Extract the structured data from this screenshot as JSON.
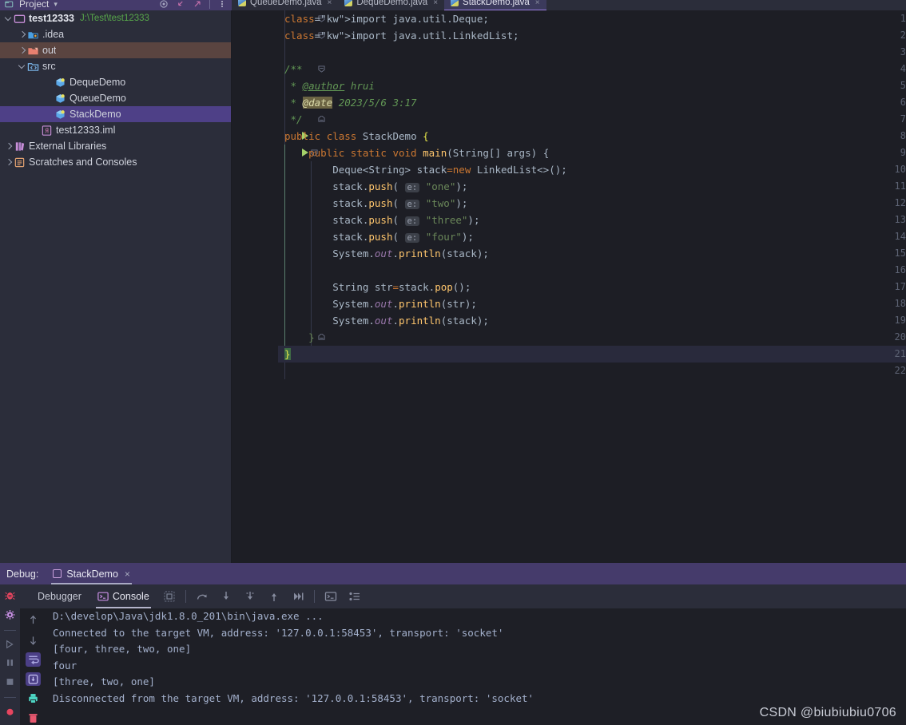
{
  "project_panel": {
    "title": "Project",
    "icons": [
      "target-icon",
      "collapse-all-icon",
      "expand-arrow-icon",
      "more-options-icon"
    ],
    "tree": [
      {
        "label": "test12333",
        "path": "J:\\Test\\test12333",
        "icon": "folder-project-icon",
        "arrow": "down",
        "indent": 0,
        "state": "normal",
        "bold": true
      },
      {
        "label": ".idea",
        "path": "",
        "icon": "folder-idea-icon",
        "arrow": "right",
        "indent": 1,
        "state": "normal",
        "bold": false
      },
      {
        "label": "out",
        "path": "",
        "icon": "folder-excluded-icon",
        "arrow": "right",
        "indent": 1,
        "state": "excluded",
        "bold": false
      },
      {
        "label": "src",
        "path": "",
        "icon": "folder-source-icon",
        "arrow": "down",
        "indent": 1,
        "state": "normal",
        "bold": false
      },
      {
        "label": "DequeDemo",
        "path": "",
        "icon": "java-class-icon",
        "arrow": "none",
        "indent": 3,
        "state": "normal",
        "bold": false
      },
      {
        "label": "QueueDemo",
        "path": "",
        "icon": "java-class-icon",
        "arrow": "none",
        "indent": 3,
        "state": "normal",
        "bold": false
      },
      {
        "label": "StackDemo",
        "path": "",
        "icon": "java-class-icon",
        "arrow": "none",
        "indent": 3,
        "state": "selected",
        "bold": false
      },
      {
        "label": "test12333.iml",
        "path": "",
        "icon": "iml-file-icon",
        "arrow": "none",
        "indent": 2,
        "state": "normal",
        "bold": false
      },
      {
        "label": "External Libraries",
        "path": "",
        "icon": "libraries-icon",
        "arrow": "right",
        "indent": 0,
        "state": "normal",
        "bold": false
      },
      {
        "label": "Scratches and Consoles",
        "path": "",
        "icon": "scratches-icon",
        "arrow": "right",
        "indent": 0,
        "state": "normal",
        "bold": false
      }
    ]
  },
  "editor_tabs": [
    {
      "label": "QueueDemo.java",
      "icon": "java-class-icon",
      "active": false
    },
    {
      "label": "DequeDemo.java",
      "icon": "java-class-icon",
      "active": false
    },
    {
      "label": "StackDemo.java",
      "icon": "java-class-icon",
      "active": true
    }
  ],
  "editor": {
    "file": "StackDemo.java",
    "caret_line": 21,
    "lines": [
      {
        "n": 1,
        "text": "import java.util.Deque;"
      },
      {
        "n": 2,
        "text": "import java.util.LinkedList;"
      },
      {
        "n": 3,
        "text": ""
      },
      {
        "n": 4,
        "text": "/**"
      },
      {
        "n": 5,
        "text": " * @author hrui"
      },
      {
        "n": 6,
        "text": " * @date 2023/5/6 3:17"
      },
      {
        "n": 7,
        "text": " */"
      },
      {
        "n": 8,
        "text": "public class StackDemo {"
      },
      {
        "n": 9,
        "text": "    public static void main(String[] args) {"
      },
      {
        "n": 10,
        "text": "        Deque<String> stack=new LinkedList<>();"
      },
      {
        "n": 11,
        "text": "        stack.push( e: \"one\");"
      },
      {
        "n": 12,
        "text": "        stack.push( e: \"two\");"
      },
      {
        "n": 13,
        "text": "        stack.push( e: \"three\");"
      },
      {
        "n": 14,
        "text": "        stack.push( e: \"four\");"
      },
      {
        "n": 15,
        "text": "        System.out.println(stack);"
      },
      {
        "n": 16,
        "text": ""
      },
      {
        "n": 17,
        "text": "        String str=stack.pop();"
      },
      {
        "n": 18,
        "text": "        System.out.println(str);"
      },
      {
        "n": 19,
        "text": "        System.out.println(stack);"
      },
      {
        "n": 20,
        "text": "    }"
      },
      {
        "n": 21,
        "text": "}"
      },
      {
        "n": 22,
        "text": ""
      }
    ],
    "javadoc": {
      "author_tag": "@author",
      "author_value": "hrui",
      "date_tag": "@date",
      "date_value": "2023/5/6 3:17"
    },
    "param_hint": "e:",
    "run_gutter_lines": [
      8,
      9
    ]
  },
  "debug": {
    "title": "Debug:",
    "session_tab": "StackDemo",
    "close_glyph": "×",
    "sub_tabs": [
      {
        "label": "Debugger",
        "active": false,
        "icon": ""
      },
      {
        "label": "Console",
        "active": true,
        "icon": "console-icon"
      }
    ],
    "toolbar_icons": [
      "layout-settings-icon",
      "step-over-icon",
      "step-into-icon",
      "force-step-into-icon",
      "step-out-icon",
      "run-to-cursor-icon",
      "show-console-icon",
      "settings-list-icon"
    ],
    "left_rail_icons": [
      "debug-bug-icon",
      "settings-gear-icon",
      "resume-program-icon",
      "pause-program-icon",
      "stop-program-icon",
      "mute-breakpoints-icon"
    ],
    "console_gutter_icons": [
      "scroll-up-icon",
      "scroll-down-icon",
      "soft-wrap-icon",
      "scroll-to-end-icon",
      "print-icon",
      "clear-all-icon"
    ],
    "console_lines": [
      {
        "text": "D:\\develop\\Java\\jdk1.8.0_201\\bin\\java.exe ...",
        "highlight": true
      },
      {
        "text": "Connected to the target VM, address: '127.0.0.1:58453', transport: 'socket'",
        "highlight": false
      },
      {
        "text": "[four, three, two, one]",
        "highlight": false
      },
      {
        "text": "four",
        "highlight": false
      },
      {
        "text": "[three, two, one]",
        "highlight": false
      },
      {
        "text": "Disconnected from the target VM, address: '127.0.0.1:58453', transport: 'socket'",
        "highlight": false
      }
    ]
  },
  "watermark": "CSDN @biubiubiu0706",
  "colors": {
    "editor_bg": "#1d1e25",
    "panel_bg": "#2b2d3a",
    "accent_purple": "#453b6b",
    "selection": "#4e4087",
    "excluded": "#5a4440",
    "string_green": "#6a8759",
    "keyword_orange": "#cc7832",
    "path_green": "#57a64a"
  }
}
